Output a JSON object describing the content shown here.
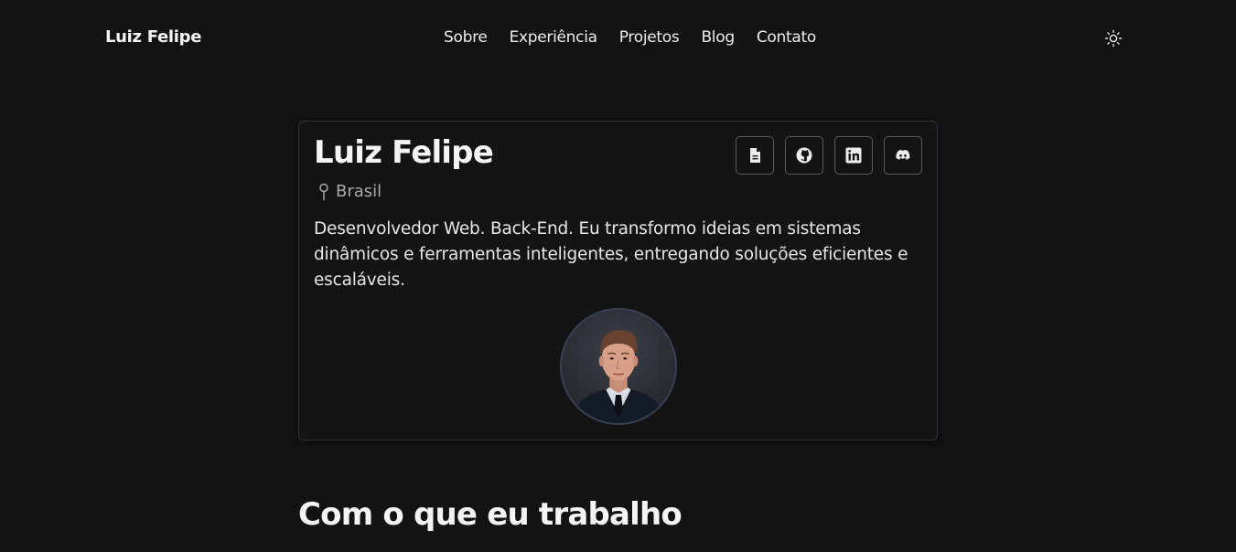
{
  "header": {
    "brand": "Luiz Felipe",
    "nav": [
      "Sobre",
      "Experiência",
      "Projetos",
      "Blog",
      "Contato"
    ],
    "theme_icon": "sun-icon"
  },
  "profile": {
    "name": "Luiz Felipe",
    "location": "Brasil",
    "location_icon": "map-pin-icon",
    "bio": "Desenvolvedor Web. Back-End. Eu transformo ideias em sistemas dinâmicos e ferramentas inteligentes, entregando soluções eficientes e escaláveis.",
    "socials": [
      "document-icon",
      "github-icon",
      "linkedin-icon",
      "discord-icon"
    ]
  },
  "sections": {
    "skills_title": "Com o que eu trabalho"
  },
  "colors": {
    "background": "#131313",
    "card_border": "#34343f",
    "text": "#ececec",
    "muted": "#a8a8a8"
  }
}
